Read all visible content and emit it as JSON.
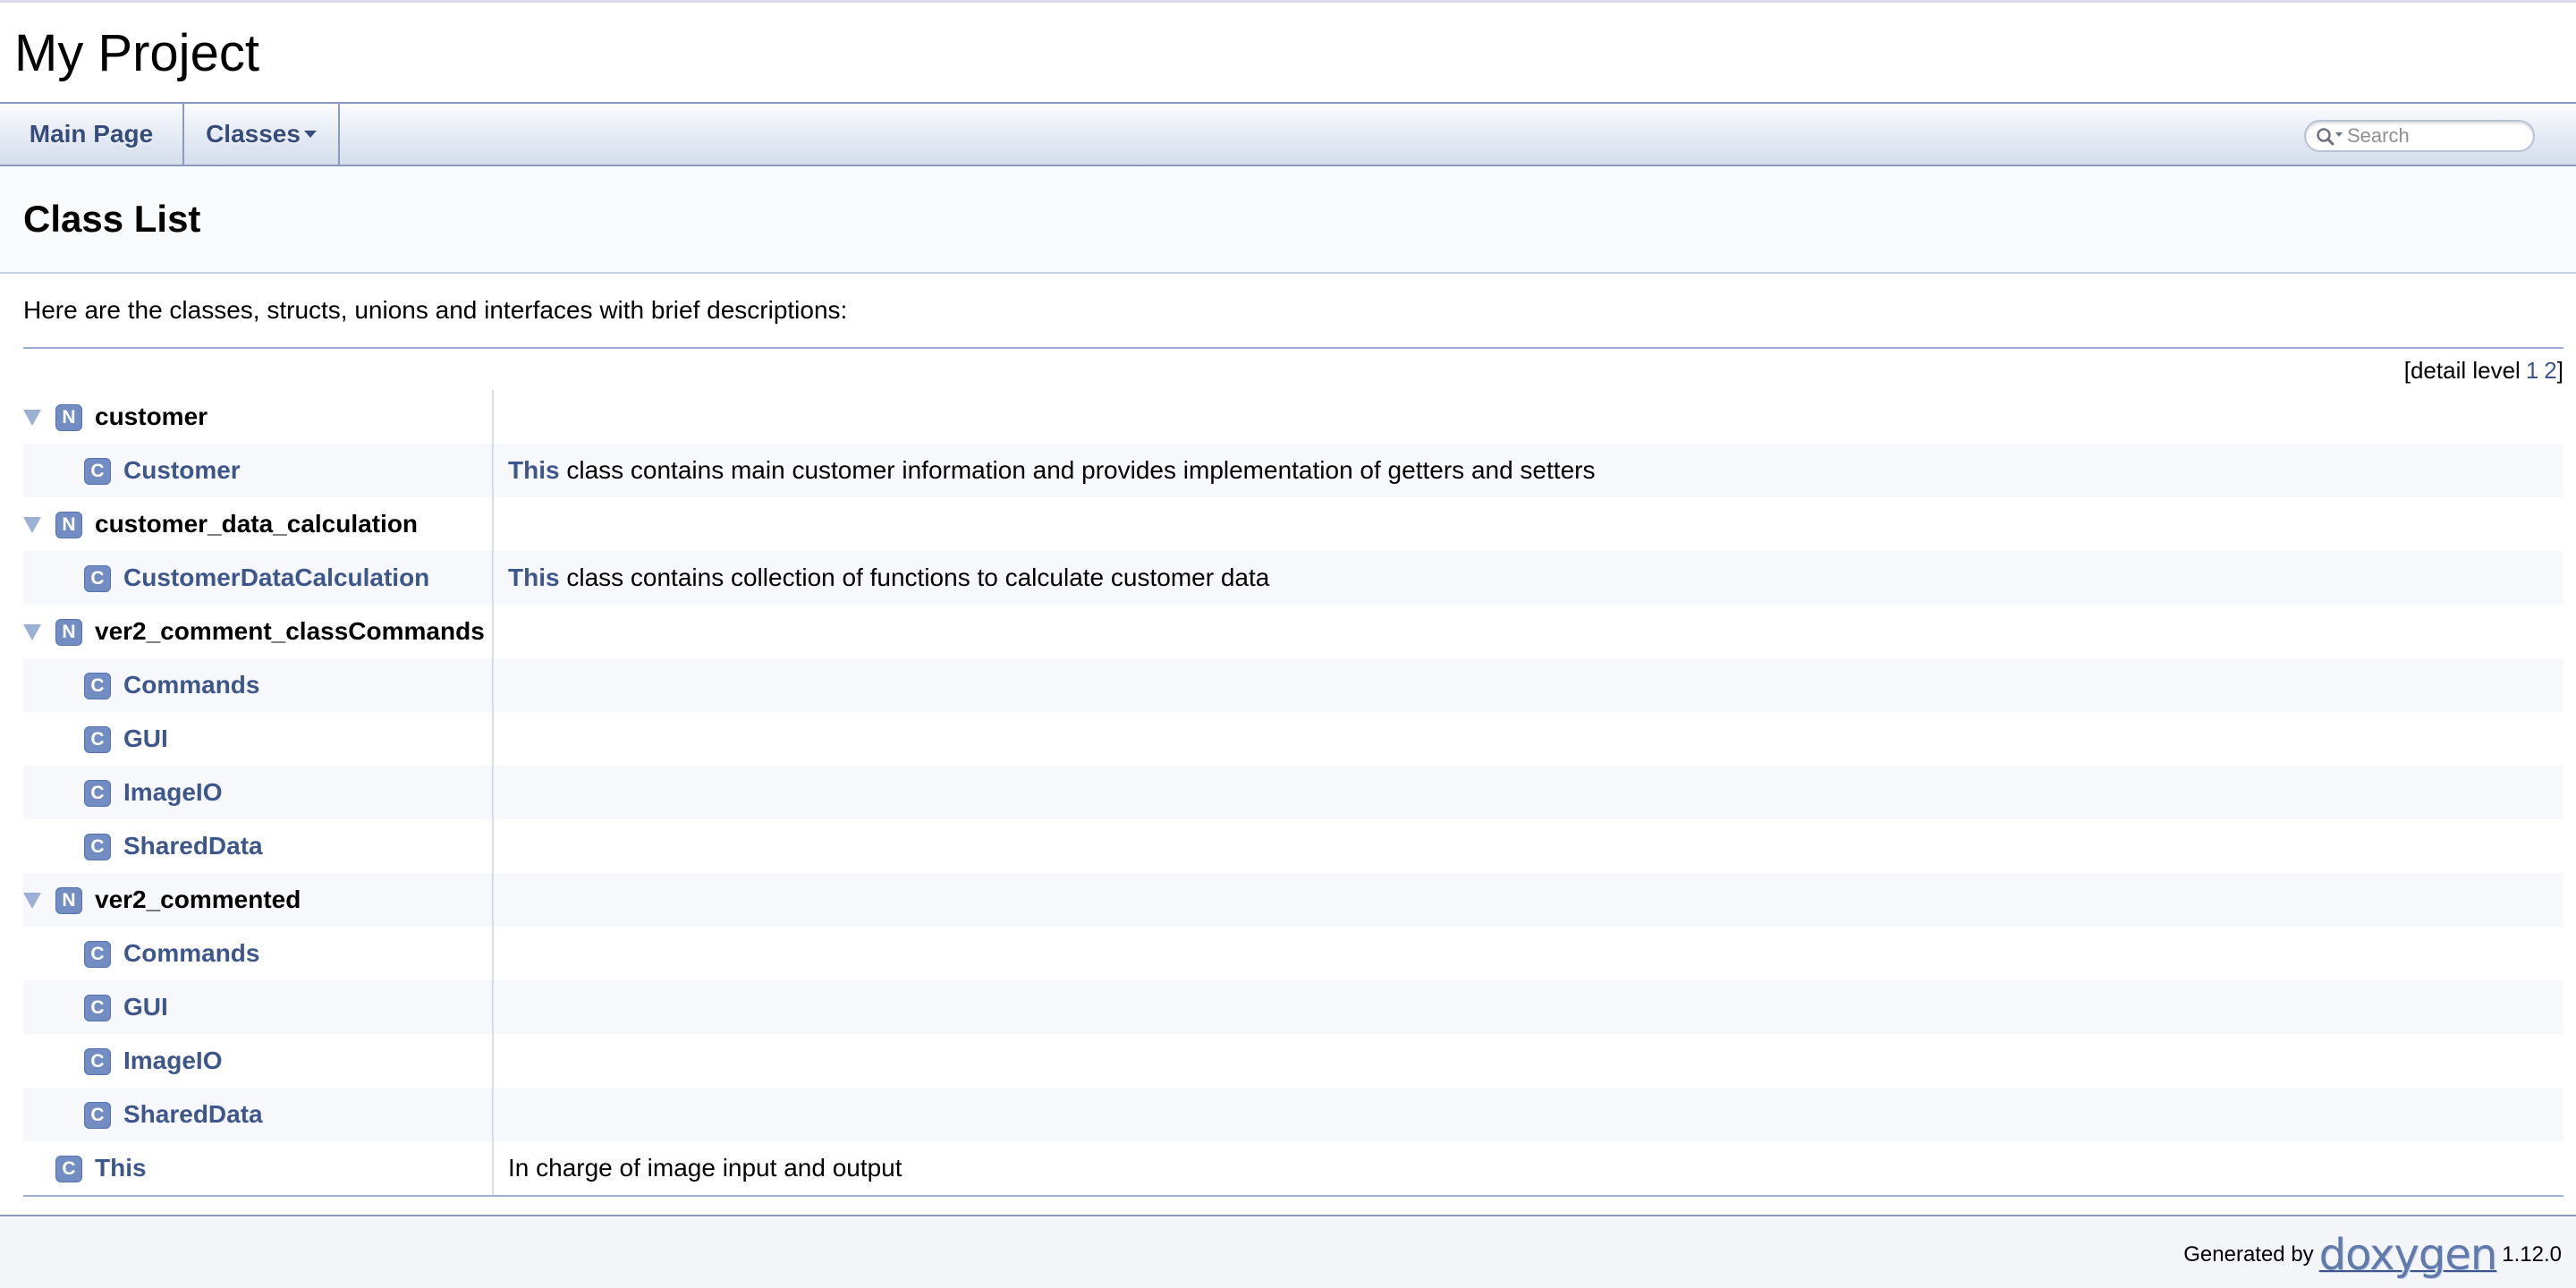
{
  "project": {
    "name": "My Project"
  },
  "nav": {
    "main_page": "Main Page",
    "classes": "Classes",
    "search_placeholder": "Search"
  },
  "header": {
    "title": "Class List"
  },
  "contents": {
    "intro": "Here are the classes, structs, unions and interfaces with brief descriptions:",
    "detail_level_label": "[detail level",
    "detail_levels": [
      "1",
      "2"
    ],
    "detail_level_close": "]"
  },
  "rows": [
    {
      "kind": "namespace",
      "badge": "N",
      "name": "customer",
      "desc_link": "",
      "desc": ""
    },
    {
      "kind": "class",
      "badge": "C",
      "name": "Customer",
      "desc_link": "This",
      "desc": " class contains main customer information and provides implementation of getters and setters"
    },
    {
      "kind": "namespace",
      "badge": "N",
      "name": "customer_data_calculation",
      "desc_link": "",
      "desc": ""
    },
    {
      "kind": "class",
      "badge": "C",
      "name": "CustomerDataCalculation",
      "desc_link": "This",
      "desc": " class contains collection of functions to calculate customer data"
    },
    {
      "kind": "namespace",
      "badge": "N",
      "name": "ver2_comment_classCommands",
      "desc_link": "",
      "desc": ""
    },
    {
      "kind": "class",
      "badge": "C",
      "name": "Commands",
      "desc_link": "",
      "desc": ""
    },
    {
      "kind": "class",
      "badge": "C",
      "name": "GUI",
      "desc_link": "",
      "desc": ""
    },
    {
      "kind": "class",
      "badge": "C",
      "name": "ImageIO",
      "desc_link": "",
      "desc": ""
    },
    {
      "kind": "class",
      "badge": "C",
      "name": "SharedData",
      "desc_link": "",
      "desc": ""
    },
    {
      "kind": "namespace",
      "badge": "N",
      "name": "ver2_commented",
      "desc_link": "",
      "desc": ""
    },
    {
      "kind": "class",
      "badge": "C",
      "name": "Commands",
      "desc_link": "",
      "desc": ""
    },
    {
      "kind": "class",
      "badge": "C",
      "name": "GUI",
      "desc_link": "",
      "desc": ""
    },
    {
      "kind": "class",
      "badge": "C",
      "name": "ImageIO",
      "desc_link": "",
      "desc": ""
    },
    {
      "kind": "class",
      "badge": "C",
      "name": "SharedData",
      "desc_link": "",
      "desc": ""
    },
    {
      "kind": "toplevel-class",
      "badge": "C",
      "name": "This",
      "desc_link": "",
      "desc": "In charge of image input and output"
    }
  ],
  "footer": {
    "generated_by": "Generated by",
    "logo_text": "doxygen",
    "version": "1.12.0"
  },
  "colors": {
    "link": "#3d578c",
    "badge": "#728dc1",
    "nav_border": "#8a9bbf",
    "row_alt": "#f7f8fb"
  }
}
